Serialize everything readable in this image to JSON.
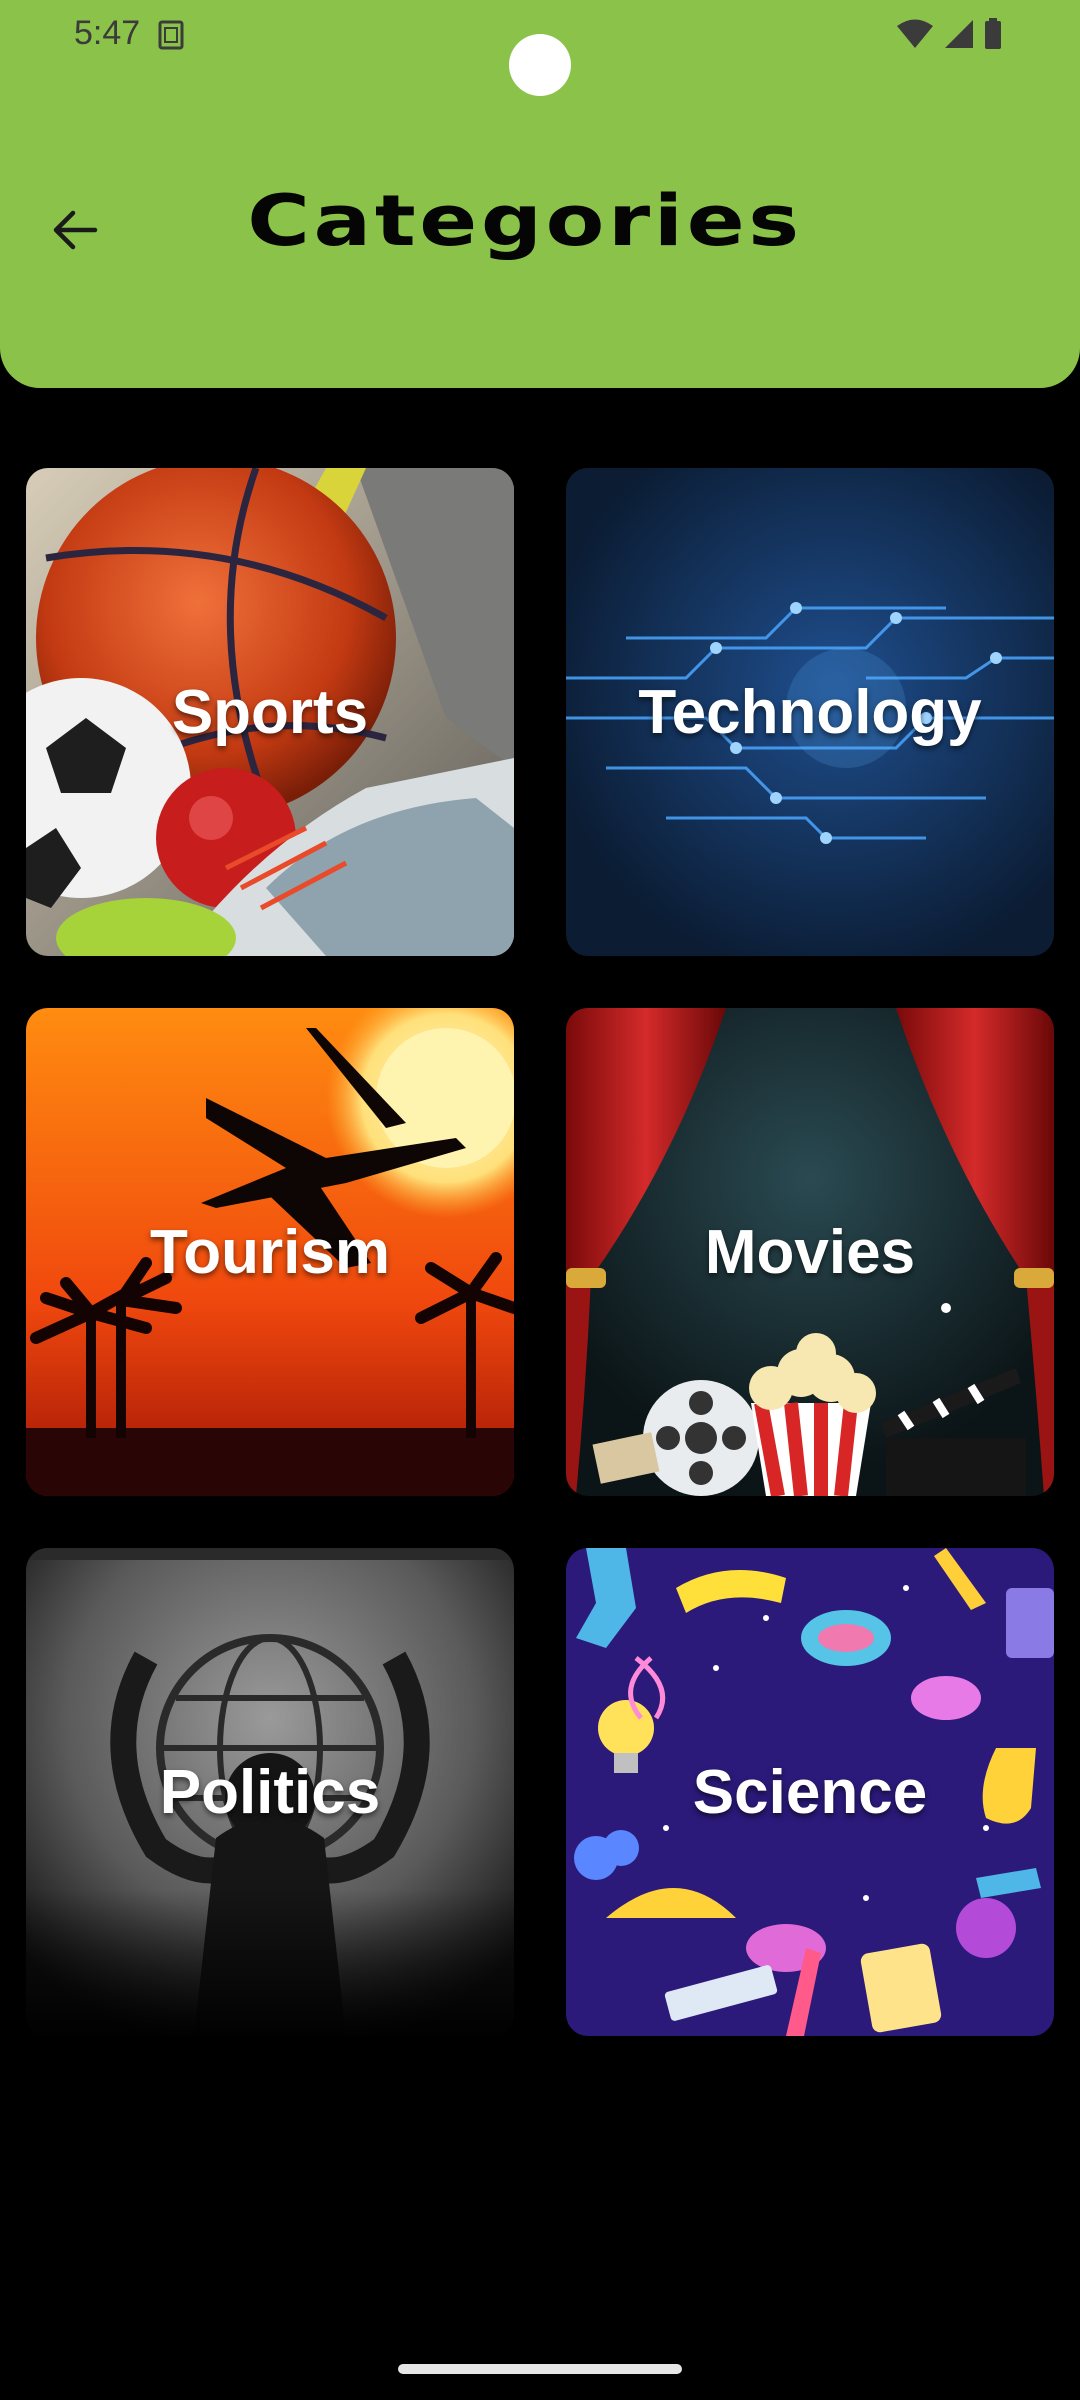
{
  "status_bar": {
    "time": "5:47",
    "icons": [
      "sim-card-icon",
      "wifi-icon",
      "signal-icon",
      "battery-icon"
    ]
  },
  "header": {
    "title": "Categories",
    "back_icon": "arrow-back-icon",
    "background_color": "#8bc34a"
  },
  "categories": [
    {
      "label": "Sports"
    },
    {
      "label": "Technology"
    },
    {
      "label": "Tourism"
    },
    {
      "label": "Movies"
    },
    {
      "label": "Politics"
    },
    {
      "label": "Science"
    }
  ],
  "colors": {
    "page_background": "#000000",
    "card_text": "#ffffff"
  }
}
